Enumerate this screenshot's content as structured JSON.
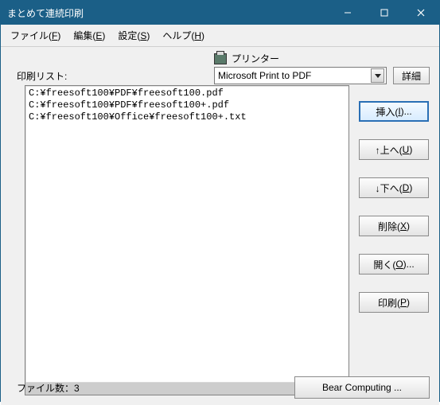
{
  "window": {
    "title": "まとめて連続印刷"
  },
  "menu": {
    "file": "ファイル(F)",
    "edit": "編集(E)",
    "settings": "設定(S)",
    "help": "ヘルプ(H)"
  },
  "printer": {
    "label": "プリンター",
    "selected": "Microsoft Print to PDF",
    "detail_btn": "詳細"
  },
  "list": {
    "label": "印刷リスト:",
    "items": [
      "C:¥freesoft100¥PDF¥freesoft100.pdf",
      "C:¥freesoft100¥PDF¥freesoft100+.pdf",
      "C:¥freesoft100¥Office¥freesoft100+.txt"
    ]
  },
  "buttons": {
    "insert": "挿入(I)...",
    "up": "↑上へ(U)",
    "down": "↓下へ(D)",
    "delete": "削除(X)",
    "open": "開く(O)...",
    "print": "印刷(P)"
  },
  "status": {
    "file_count": "ファイル数：3",
    "vendor_btn": "Bear Computing ..."
  }
}
